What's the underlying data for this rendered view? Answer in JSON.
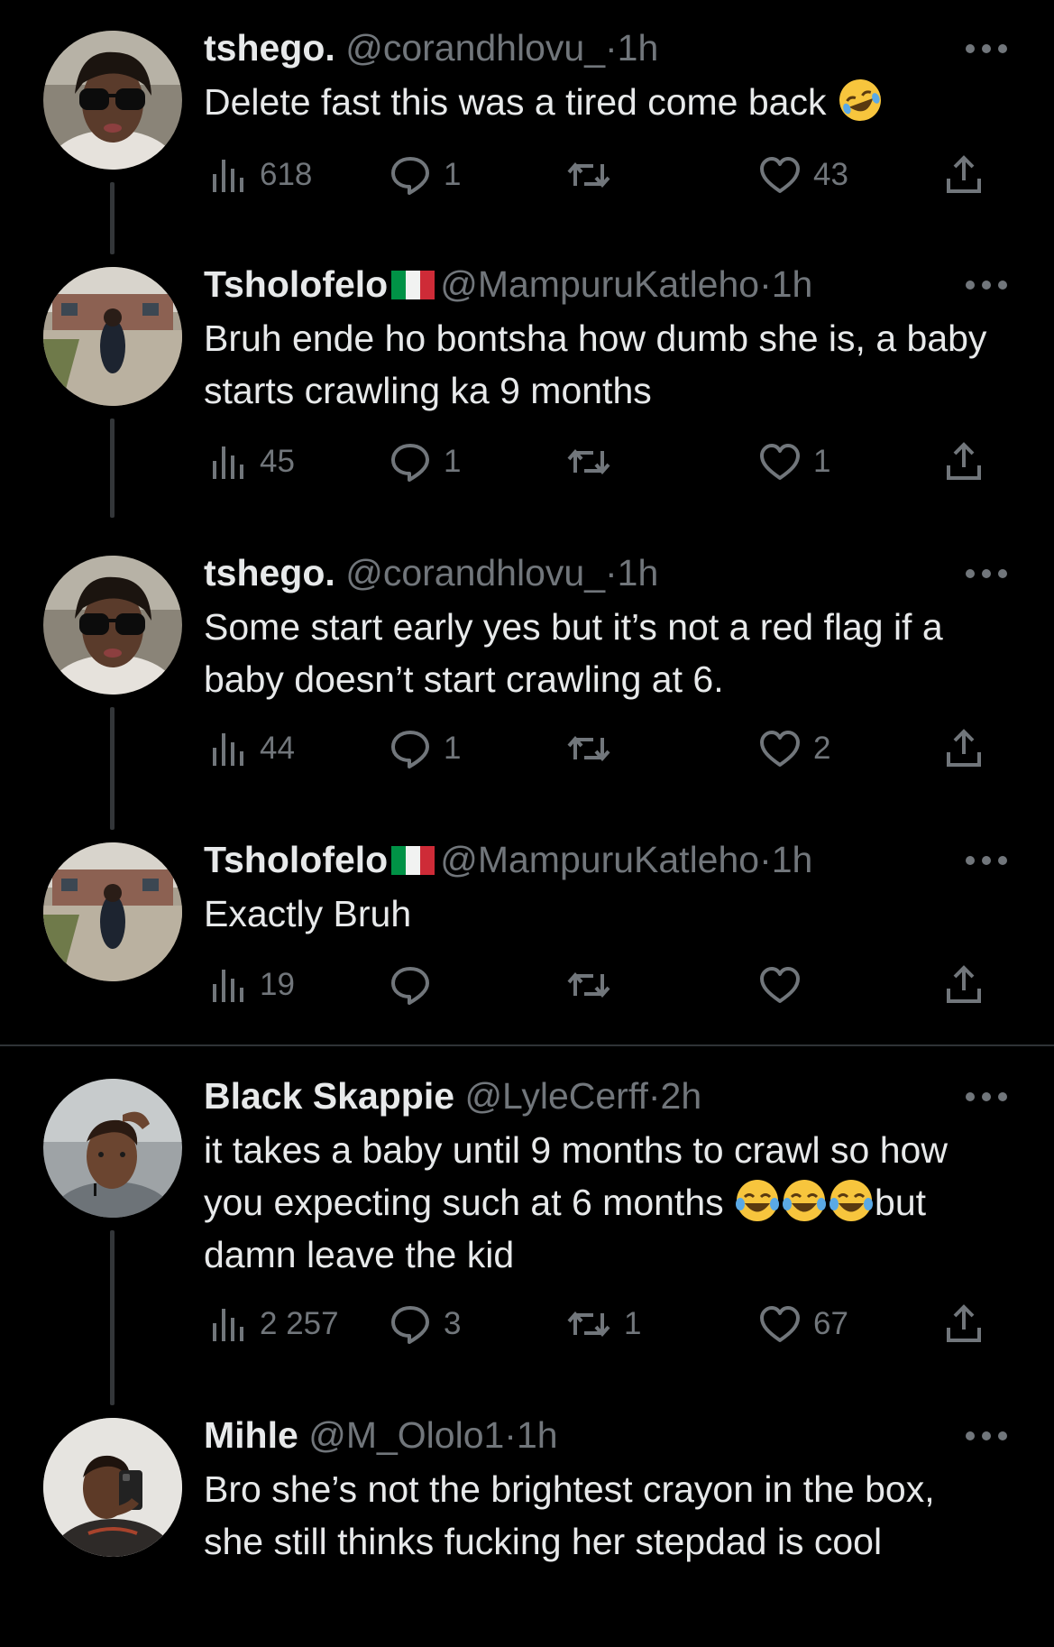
{
  "tweets": [
    {
      "name": "tshego.",
      "handle": "@corandhlovu_",
      "dot": "·",
      "time": "1h",
      "text": "Delete fast this was a tired come back ",
      "emoji": "rolling-on-floor-laughing",
      "views": "618",
      "replies": "1",
      "retweets": "",
      "likes": "43"
    },
    {
      "name": "Tsholofelo",
      "flag": "italy-flag",
      "handle": "@MampuruKatleho",
      "dot": "·",
      "time": "1h",
      "text": "Bruh ende ho bontsha how dumb she is, a baby starts crawling ka 9 months",
      "views": "45",
      "replies": "1",
      "retweets": "",
      "likes": "1"
    },
    {
      "name": "tshego.",
      "handle": "@corandhlovu_",
      "dot": "·",
      "time": "1h",
      "text": "Some start early yes but it’s not a red flag if a baby doesn’t start crawling at 6.",
      "views": "44",
      "replies": "1",
      "retweets": "",
      "likes": "2"
    },
    {
      "name": "Tsholofelo",
      "flag": "italy-flag",
      "handle": "@MampuruKatleho",
      "dot": "·",
      "time": "1h",
      "text": "Exactly Bruh",
      "views": "19",
      "replies": "",
      "retweets": "",
      "likes": ""
    },
    {
      "name": "Black Skappie",
      "handle": "@LyleCerff",
      "dot": "·",
      "time": "2h",
      "text_a": "it takes a baby until 9 months to crawl so how you expecting such at 6 months ",
      "emoji": "face-with-tears-of-joy",
      "text_b": "but damn leave the kid",
      "views": "2 257",
      "replies": "3",
      "retweets": "1",
      "likes": "67"
    },
    {
      "name": "Mihle",
      "handle": "@M_Ololo1",
      "dot": "·",
      "time": "1h",
      "text": "Bro she’s not the brightest crayon in the box, she still thinks fucking her stepdad is cool"
    }
  ],
  "colors": {
    "background": "#000000",
    "text": "#e7e9ea",
    "secondary": "#71767b",
    "thread_line": "#333639",
    "divider": "#2f3336"
  },
  "icons": [
    "views-icon",
    "reply-icon",
    "retweet-icon",
    "like-icon",
    "share-icon",
    "more-icon"
  ]
}
